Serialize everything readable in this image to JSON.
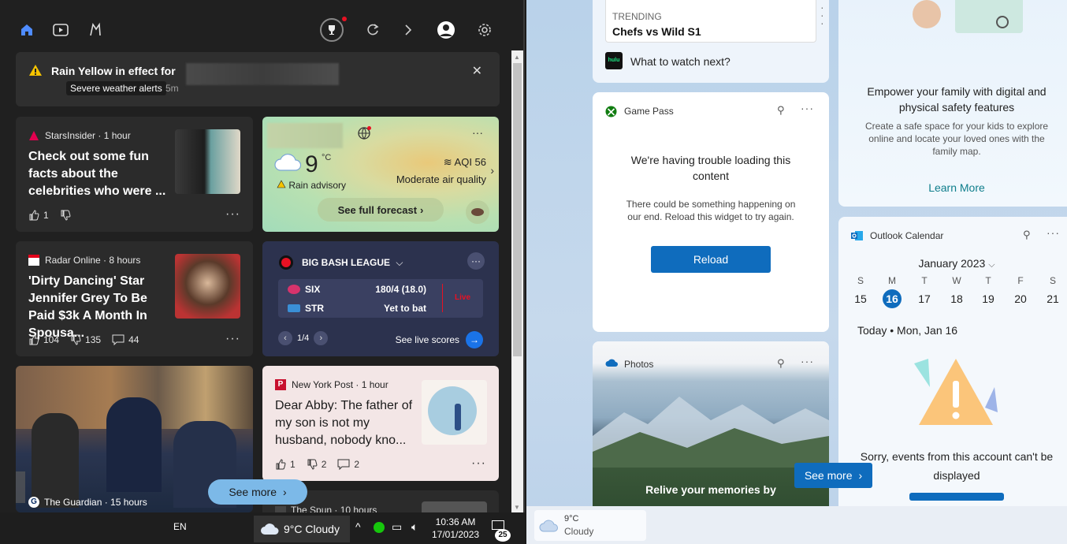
{
  "alert": {
    "title": "Rain Yellow in effect for",
    "chip": "Severe weather alerts",
    "time": "5m"
  },
  "cards": {
    "stars": {
      "source": "StarsInsider · 1 hour",
      "headline": "Check out some fun facts about the celebrities who were ...",
      "likes": "1"
    },
    "radar": {
      "source": "Radar Online · 8 hours",
      "headline": "'Dirty Dancing' Star Jennifer Grey To Be Paid $3k A Month In Spousa...",
      "likes": "104",
      "dislikes": "135",
      "comments": "44"
    },
    "guardian": {
      "source": "The Guardian · 15 hours"
    },
    "nypost": {
      "source": "New York Post · 1 hour",
      "headline": "Dear Abby: The father of my son is not my husband, nobody kno...",
      "likes": "1",
      "dislikes": "2",
      "comments": "2"
    },
    "spun": {
      "source": "The Spun · 10 hours"
    }
  },
  "weather": {
    "temp": "9",
    "unit": "°C",
    "advisory": "Rain advisory",
    "aqi": "AQI 56",
    "quality": "Moderate air quality",
    "forecast_btn": "See full forecast"
  },
  "sports": {
    "league": "BIG BASH LEAGUE",
    "team1": "SIX",
    "score1": "180/4 (18.0)",
    "team2": "STR",
    "score2": "Yet to bat",
    "live_tag": "Live",
    "page": "1/4",
    "live_link": "See live scores"
  },
  "see_more_left": "See more",
  "right": {
    "trending_label": "TRENDING",
    "trending_title": "Chefs vs Wild S1",
    "hulu_label": "hulu",
    "hulu_text": "What to watch next?",
    "family_title": "Empower your family with digital and physical safety features",
    "family_desc": "Create a safe space for your kids to explore online and locate your loved ones with the family map.",
    "family_link": "Learn More",
    "gamepass_title": "Game Pass",
    "gp_err_title": "We're having trouble loading this content",
    "gp_err_desc": "There could be something happening on our end. Reload this widget to try again.",
    "reload": "Reload",
    "outlook_title": "Outlook Calendar",
    "month": "January 2023",
    "dow": [
      "S",
      "M",
      "T",
      "W",
      "T",
      "F",
      "S"
    ],
    "days": [
      "15",
      "16",
      "17",
      "18",
      "19",
      "20",
      "21"
    ],
    "today": "Today • Mon, Jan 16",
    "cal_error": "Sorry, events from this account can't be displayed",
    "photos_title": "Photos",
    "photos_caption": "Relive your memories by",
    "see_more": "See more"
  },
  "taskbar": {
    "lang": "EN",
    "weather": "9°C  Cloudy",
    "time": "10:36 AM",
    "date": "17/01/2023",
    "notif": "25",
    "r_temp": "9°C",
    "r_cond": "Cloudy"
  }
}
